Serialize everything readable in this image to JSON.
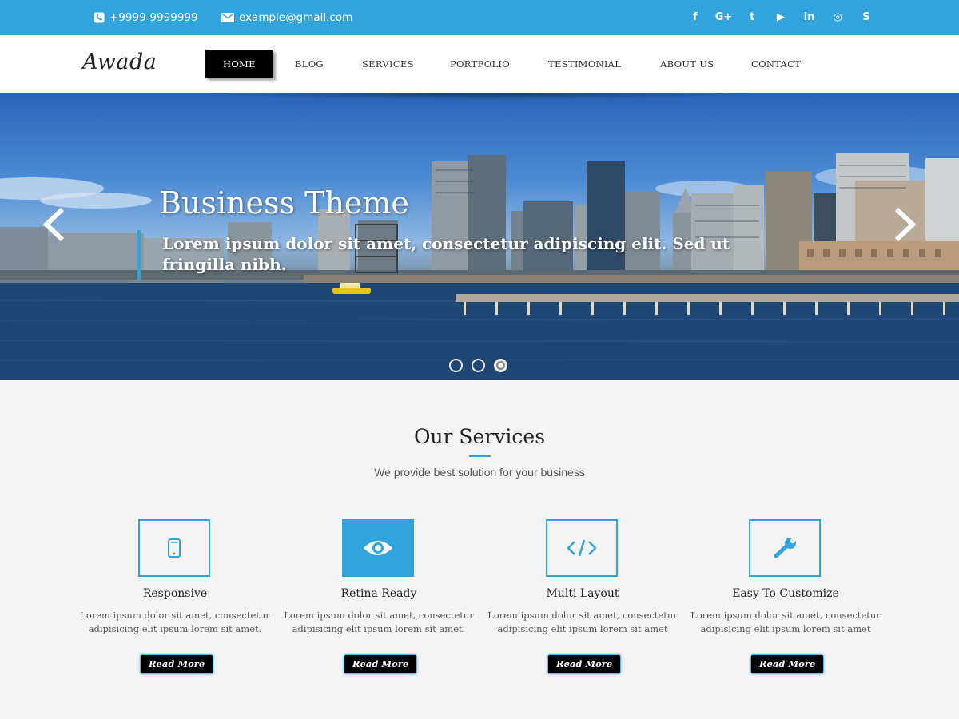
{
  "topbar": {
    "phone": "+9999-9999999",
    "email": "example@gmail.com",
    "social": [
      {
        "icon": "facebook-icon",
        "glyph": "f"
      },
      {
        "icon": "google-plus-icon",
        "glyph": "G+"
      },
      {
        "icon": "twitter-icon",
        "glyph": "t"
      },
      {
        "icon": "youtube-icon",
        "glyph": "▶"
      },
      {
        "icon": "linkedin-icon",
        "glyph": "in"
      },
      {
        "icon": "dribbble-icon",
        "glyph": "◎"
      },
      {
        "icon": "skype-icon",
        "glyph": "S"
      }
    ]
  },
  "header": {
    "logo": "Awada",
    "nav": [
      "HOME",
      "BLOG",
      "SERVICES",
      "PORTFOLIO",
      "TESTIMONIAL",
      "ABOUT US",
      "CONTACT"
    ],
    "active": "HOME"
  },
  "hero": {
    "title": "Business Theme",
    "subtitle": "Lorem ipsum dolor sit amet, consectetur adipiscing elit. Sed ut fringilla nibh.",
    "slides": 3,
    "active_slide": 3
  },
  "services": {
    "title": "Our Services",
    "subtitle": "We provide best solution for your business",
    "items": [
      {
        "name": "Responsive",
        "icon": "mobile-icon",
        "desc": "Lorem ipsum dolor sit amet, consectetur adipisicing elit ipsum lorem sit amet.",
        "button": "Read More",
        "highlighted": false
      },
      {
        "name": "Retina Ready",
        "icon": "eye-icon",
        "desc": "Lorem ipsum dolor sit amet, consectetur adipisicing elit ipsum lorem sit amet.",
        "button": "Read More",
        "highlighted": true
      },
      {
        "name": "Multi Layout",
        "icon": "code-icon",
        "desc": "Lorem ipsum dolor sit amet, consectetur adipisicing elit ipsum lorem sit amet",
        "button": "Read More",
        "highlighted": false
      },
      {
        "name": "Easy To Customize",
        "icon": "wrench-icon",
        "desc": "Lorem ipsum dolor sit amet, consectetur adipisicing elit ipsum lorem sit amet",
        "button": "Read More",
        "highlighted": false
      }
    ]
  },
  "colors": {
    "accent": "#31a3dd",
    "nav_active_bg": "#000000",
    "button_bg": "#000000"
  }
}
